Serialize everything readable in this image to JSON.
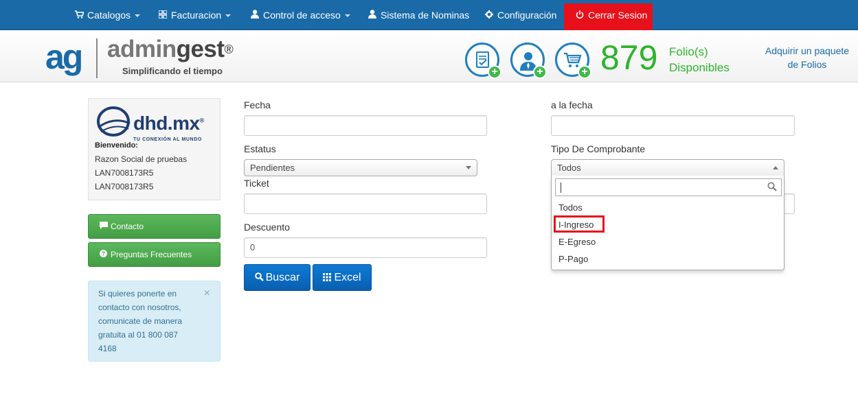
{
  "nav": {
    "items": [
      {
        "label": "Catalogos",
        "icon": "cart-icon",
        "dropdown": true
      },
      {
        "label": "Facturacion",
        "icon": "grid-icon",
        "dropdown": true
      },
      {
        "label": "Control de acceso",
        "icon": "user-icon",
        "dropdown": true
      },
      {
        "label": "Sistema de Nominas",
        "icon": "user-icon",
        "dropdown": false
      },
      {
        "label": "Configuración",
        "icon": "gear-icon",
        "dropdown": false
      }
    ],
    "logout_label": "Cerrar Sesion",
    "logout_color": "#e8101a",
    "bar_color": "#1a6aa8"
  },
  "brand": {
    "mark": "ag",
    "name_a": "admin",
    "name_b": "gest",
    "reg": "®",
    "tagline": "Simplificando el tiempo"
  },
  "folios": {
    "count": "879",
    "label_line1": "Folio(s)",
    "label_line2": "Disponibles",
    "buy_line1": "Adquirir un paquete",
    "buy_line2": "de Folios",
    "color": "#2bb52b"
  },
  "user": {
    "company_logo_text": "dhd.mx",
    "company_logo_reg": "®",
    "company_logo_sub": "TU CONEXIÓN AL MUNDO",
    "welcome": "Bienvenido:",
    "razon_social": "Razon Social de pruebas",
    "rfc_1": "LAN7008173R5",
    "rfc_2": "LAN7008173R5"
  },
  "sidebar": {
    "contact_label": "Contacto",
    "faq_label": "Preguntas Frecuentes",
    "alert_text": "Si quieres ponerte en contacto con nosotros, comunicate de manera gratuita al 01 800 087 4168",
    "alert_close": "×"
  },
  "form": {
    "fecha_label": "Fecha",
    "fecha_value": "",
    "a_la_fecha_label": "a la fecha",
    "a_la_fecha_value": "",
    "estatus_label": "Estatus",
    "estatus_value": "Pendientes",
    "tipo_label": "Tipo De Comprobante",
    "tipo_value": "Todos",
    "ticket_label": "Ticket",
    "ticket_value": "",
    "descuento_label": "Descuento",
    "descuento_value": "0",
    "search_label": "Buscar",
    "excel_label": "Excel"
  },
  "dropdown": {
    "search_value": "",
    "options": [
      "Todos",
      "I-Ingreso",
      "E-Egreso",
      "P-Pago"
    ],
    "highlighted": "I-Ingreso"
  }
}
